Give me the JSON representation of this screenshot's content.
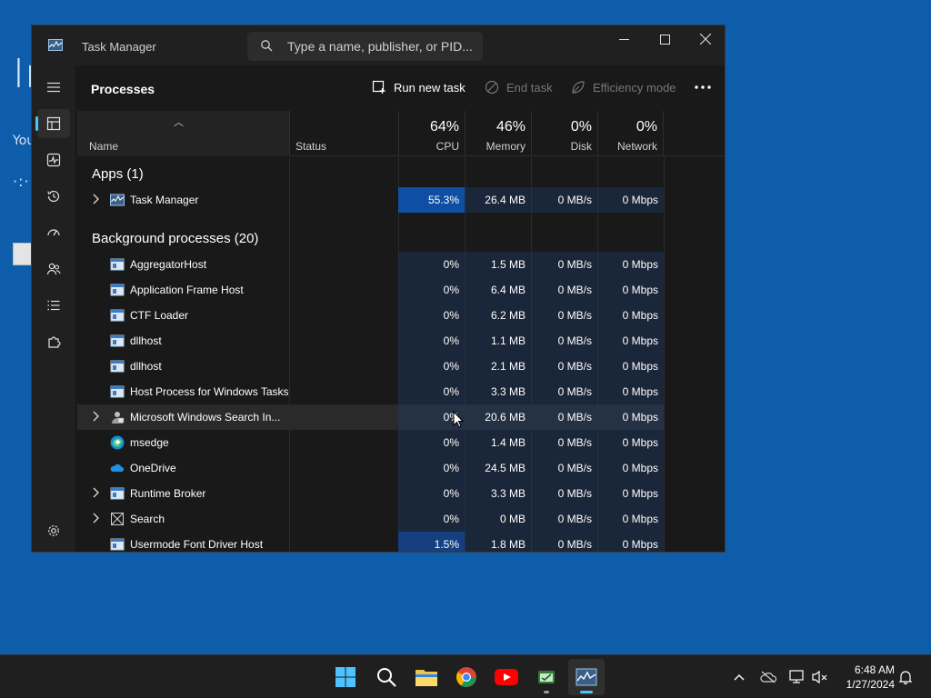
{
  "desktop": {
    "big_text": "Ir",
    "you_text": "You",
    "dots": "·:·"
  },
  "window": {
    "title": "Task Manager",
    "search_placeholder": "Type a name, publisher, or PID..."
  },
  "nav": [
    "processes",
    "performance",
    "app-history",
    "startup-apps",
    "users",
    "details",
    "services",
    "settings"
  ],
  "page": {
    "title": "Processes",
    "run_new_task": "Run new task",
    "end_task": "End task",
    "efficiency_mode": "Efficiency mode"
  },
  "columns": {
    "name": "Name",
    "status": "Status",
    "cpu_pct": "64%",
    "cpu": "CPU",
    "mem_pct": "46%",
    "mem": "Memory",
    "disk_pct": "0%",
    "disk": "Disk",
    "net_pct": "0%",
    "net": "Network"
  },
  "groups": {
    "apps": "Apps (1)",
    "background": "Background processes (20)"
  },
  "apps": [
    {
      "name": "Task Manager",
      "cpu": "55.3%",
      "mem": "26.4 MB",
      "disk": "0 MB/s",
      "net": "0 Mbps",
      "expandable": true,
      "icon": "taskmgr-icon"
    }
  ],
  "background": [
    {
      "name": "AggregatorHost",
      "cpu": "0%",
      "mem": "1.5 MB",
      "disk": "0 MB/s",
      "net": "0 Mbps",
      "icon": "window-icon"
    },
    {
      "name": "Application Frame Host",
      "cpu": "0%",
      "mem": "6.4 MB",
      "disk": "0 MB/s",
      "net": "0 Mbps",
      "icon": "window-icon"
    },
    {
      "name": "CTF Loader",
      "cpu": "0%",
      "mem": "6.2 MB",
      "disk": "0 MB/s",
      "net": "0 Mbps",
      "icon": "window-icon"
    },
    {
      "name": "dllhost",
      "cpu": "0%",
      "mem": "1.1 MB",
      "disk": "0 MB/s",
      "net": "0 Mbps",
      "icon": "window-icon"
    },
    {
      "name": "dllhost",
      "cpu": "0%",
      "mem": "2.1 MB",
      "disk": "0 MB/s",
      "net": "0 Mbps",
      "icon": "window-icon"
    },
    {
      "name": "Host Process for Windows Tasks",
      "cpu": "0%",
      "mem": "3.3 MB",
      "disk": "0 MB/s",
      "net": "0 Mbps",
      "icon": "window-icon"
    },
    {
      "name": "Microsoft Windows Search In...",
      "cpu": "0%",
      "mem": "20.6 MB",
      "disk": "0 MB/s",
      "net": "0 Mbps",
      "expandable": true,
      "hover": true,
      "icon": "search-indexer-icon"
    },
    {
      "name": "msedge",
      "cpu": "0%",
      "mem": "1.4 MB",
      "disk": "0 MB/s",
      "net": "0 Mbps",
      "icon": "edge-icon"
    },
    {
      "name": "OneDrive",
      "cpu": "0%",
      "mem": "24.5 MB",
      "disk": "0 MB/s",
      "net": "0 Mbps",
      "icon": "onedrive-icon"
    },
    {
      "name": "Runtime Broker",
      "cpu": "0%",
      "mem": "3.3 MB",
      "disk": "0 MB/s",
      "net": "0 Mbps",
      "expandable": true,
      "icon": "window-icon"
    },
    {
      "name": "Search",
      "cpu": "0%",
      "mem": "0 MB",
      "disk": "0 MB/s",
      "net": "0 Mbps",
      "expandable": true,
      "icon": "suspended-icon"
    },
    {
      "name": "Usermode Font Driver Host",
      "cpu": "1.5%",
      "mem": "1.8 MB",
      "disk": "0 MB/s",
      "net": "0 Mbps",
      "cpu_warm": true,
      "icon": "window-icon"
    }
  ],
  "taskbar": {
    "apps": [
      "start-icon",
      "search-icon",
      "file-explorer-icon",
      "chrome-icon",
      "youtube-icon",
      "app-icon",
      "task-manager-icon"
    ],
    "time": "6:48 AM",
    "date": "1/27/2024"
  },
  "colors": {
    "accent": "#4cc2ff",
    "cpu_hot": "#0e4ea3",
    "desktop": "#0d5dab"
  }
}
